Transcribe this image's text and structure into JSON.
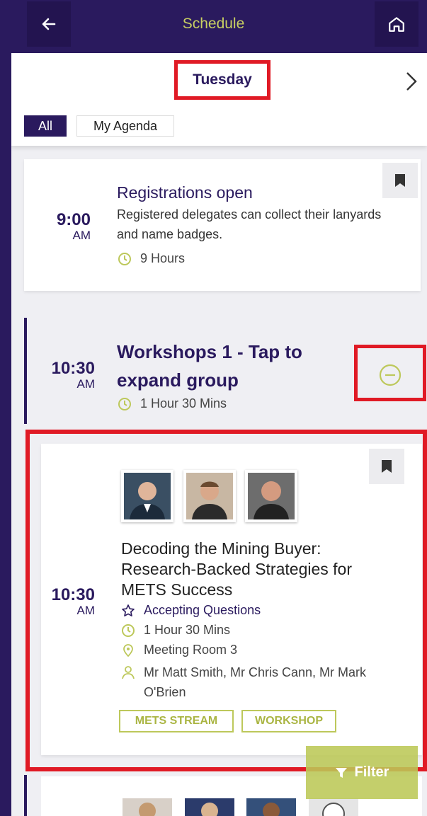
{
  "header": {
    "title": "Schedule",
    "back_icon": "arrow-left-icon",
    "home_icon": "home-icon"
  },
  "day": {
    "label": "Tuesday"
  },
  "filters": {
    "all": "All",
    "my_agenda": "My Agenda"
  },
  "colors": {
    "brand": "#2a1a5e",
    "accent": "#c8cf62",
    "tag": "#bdc85b",
    "highlight": "#e01a25"
  },
  "events": [
    {
      "time": "9:00",
      "ampm": "AM",
      "title": "Registrations open",
      "desc_line1": "Registered delegates can collect their lanyards",
      "desc_line2": "and name badges.",
      "duration": "9 Hours"
    }
  ],
  "group": {
    "time": "10:30",
    "ampm": "AM",
    "title": "Workshops 1 - Tap to expand group",
    "duration": "1 Hour 30 Mins"
  },
  "workshop": {
    "time": "10:30",
    "ampm": "AM",
    "title": "Decoding the Mining Buyer: Research-Backed Strategies for METS Success",
    "questions": "Accepting Questions",
    "duration": "1 Hour 30 Mins",
    "room": "Meeting Room 3",
    "speakers_line1": "Mr Matt Smith, Mr Chris Cann, Mr Mark",
    "speakers_line2": "O'Brien",
    "tags": [
      "METS STREAM",
      "WORKSHOP"
    ]
  },
  "filter": {
    "label": "Filter"
  }
}
